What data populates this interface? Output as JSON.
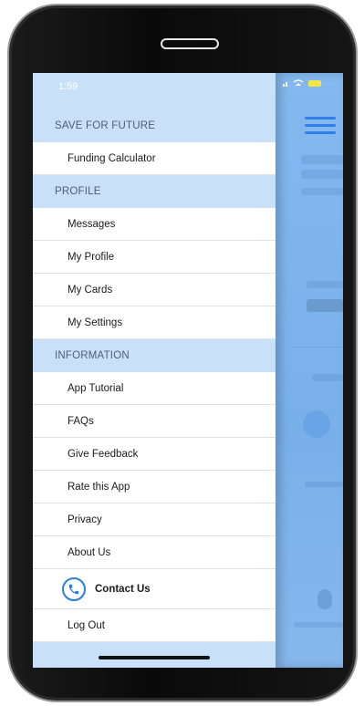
{
  "status_bar": {
    "time": "1:59"
  },
  "menu": {
    "sections": [
      {
        "title": "SAVE FOR FUTURE",
        "items": [
          "Funding Calculator"
        ]
      },
      {
        "title": "PROFILE",
        "items": [
          "Messages",
          "My Profile",
          "My Cards",
          "My Settings"
        ]
      },
      {
        "title": "INFORMATION",
        "items": [
          "App Tutorial",
          "FAQs",
          "Give Feedback",
          "Rate this App",
          "Privacy",
          "About Us"
        ]
      }
    ],
    "contact_label": "Contact Us",
    "logout_label": "Log Out"
  },
  "icons": {
    "contact": "phone-icon",
    "menu": "hamburger-menu-icon"
  },
  "colors": {
    "accent": "#2b7de0",
    "section_bg": "#c9e1f8",
    "backdrop": "#7fb4ec"
  }
}
